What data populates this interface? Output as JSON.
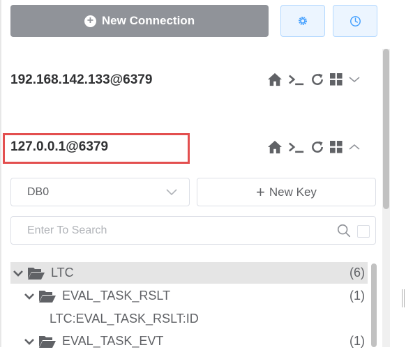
{
  "toolbar": {
    "new_connection_label": "New Connection",
    "settings_icon": "gear-icon",
    "history_icon": "clock-icon"
  },
  "connections": [
    {
      "name": "192.168.142.133@6379",
      "expanded": false
    },
    {
      "name": "127.0.0.1@6379",
      "expanded": true
    }
  ],
  "db_select": {
    "value": "DB0"
  },
  "new_key_label": "New Key",
  "search": {
    "placeholder": "Enter To Search"
  },
  "tree": [
    {
      "label": "LTC",
      "count": "(6)",
      "type": "folder",
      "expanded": true
    },
    {
      "label": "EVAL_TASK_RSLT",
      "count": "(1)",
      "type": "folder",
      "expanded": true
    },
    {
      "label": "LTC:EVAL_TASK_RSLT:ID",
      "count": "",
      "type": "key"
    },
    {
      "label": "EVAL_TASK_EVT",
      "count": "(1)",
      "type": "folder",
      "expanded": true
    }
  ],
  "colors": {
    "primary_button": "#909399",
    "accent_blue": "#409eff",
    "highlight_border": "#e34f4f"
  }
}
